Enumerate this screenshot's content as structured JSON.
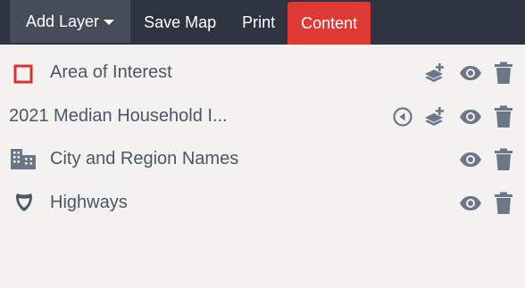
{
  "toolbar": {
    "add_layer_label": "Add Layer",
    "save_map_label": "Save Map",
    "print_label": "Print",
    "content_label": "Content",
    "active_tab_color": "#de3a33",
    "bar_color": "#2d3440"
  },
  "layers": [
    {
      "label": "Area of Interest",
      "icon": "square-outline-icon",
      "actions": [
        "add-layers-icon",
        "eye-icon",
        "trash-icon"
      ]
    },
    {
      "label": "2021 Median Household I...",
      "icon": "",
      "actions": [
        "caret-left-circle-icon",
        "add-layers-icon",
        "eye-icon",
        "trash-icon"
      ]
    },
    {
      "label": "City and Region Names",
      "icon": "city-icon",
      "actions": [
        "eye-icon",
        "trash-icon"
      ]
    },
    {
      "label": "Highways",
      "icon": "highway-shield-icon",
      "actions": [
        "eye-icon",
        "trash-icon"
      ]
    }
  ],
  "colors": {
    "icon_gray": "#6b7788",
    "aoi_red": "#d9332b",
    "text": "#4b5666",
    "background": "#f3f2f0"
  }
}
